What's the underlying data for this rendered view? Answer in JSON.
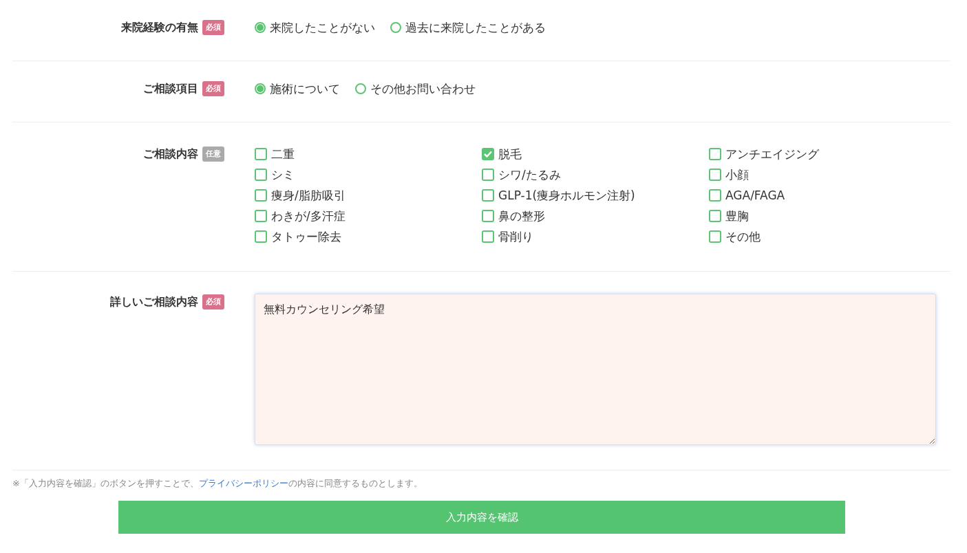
{
  "form": {
    "rows": [
      {
        "label": "来院経験の有無",
        "badge": {
          "text": "必須",
          "kind": "required"
        },
        "kind": "radio",
        "options": [
          {
            "label": "来院したことがない",
            "selected": true
          },
          {
            "label": "過去に来院したことがある",
            "selected": false
          }
        ]
      },
      {
        "label": "ご相談項目",
        "badge": {
          "text": "必須",
          "kind": "required"
        },
        "kind": "radio",
        "options": [
          {
            "label": "施術について",
            "selected": true
          },
          {
            "label": "その他お問い合わせ",
            "selected": false
          }
        ]
      },
      {
        "label": "ご相談内容",
        "badge": {
          "text": "任意",
          "kind": "optional"
        },
        "kind": "checkbox",
        "options": [
          {
            "label": "二重",
            "checked": false
          },
          {
            "label": "脱毛",
            "checked": true
          },
          {
            "label": "アンチエイジング",
            "checked": false
          },
          {
            "label": "シミ",
            "checked": false
          },
          {
            "label": "シワ/たるみ",
            "checked": false
          },
          {
            "label": "小顔",
            "checked": false
          },
          {
            "label": "痩身/脂肪吸引",
            "checked": false
          },
          {
            "label": "GLP-1(痩身ホルモン注射)",
            "checked": false
          },
          {
            "label": "AGA/FAGA",
            "checked": false
          },
          {
            "label": "わきが/多汗症",
            "checked": false
          },
          {
            "label": "鼻の整形",
            "checked": false
          },
          {
            "label": "豊胸",
            "checked": false
          },
          {
            "label": "タトゥー除去",
            "checked": false
          },
          {
            "label": "骨削り",
            "checked": false
          },
          {
            "label": "その他",
            "checked": false
          }
        ]
      },
      {
        "label": "詳しいご相談内容",
        "badge": {
          "text": "必須",
          "kind": "required"
        },
        "kind": "textarea",
        "value": "無料カウンセリング希望"
      }
    ],
    "notice": {
      "before": "※「入力内容を確認」のボタンを押すことで、",
      "link": "プライバシーポリシー",
      "after": "の内容に同意するものとします。"
    },
    "submit": "入力内容を確認"
  }
}
